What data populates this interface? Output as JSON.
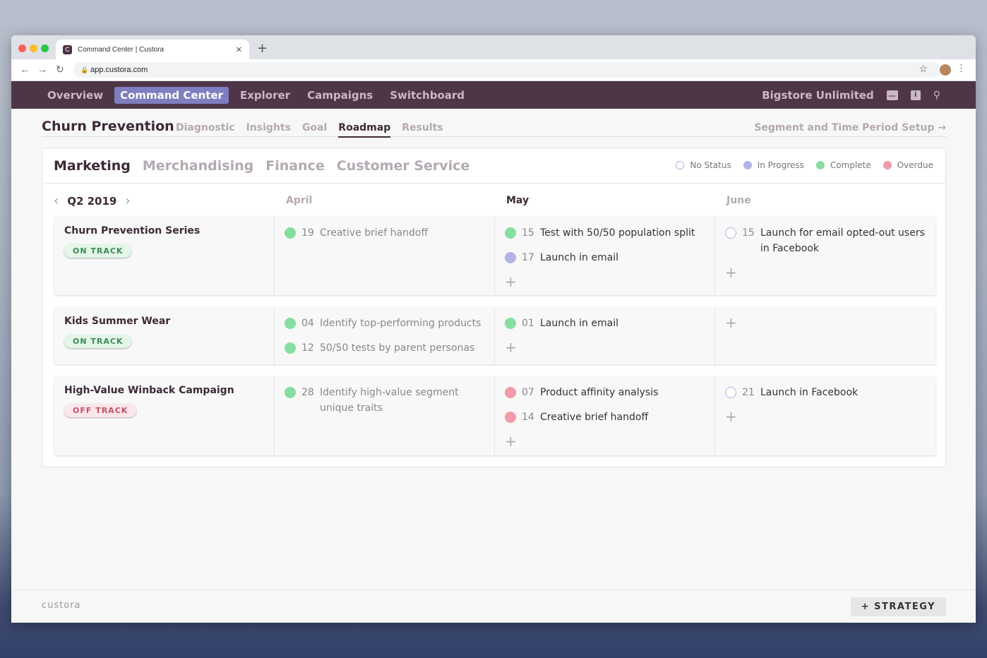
{
  "browser": {
    "tab_title": "Command Center | Custora",
    "url": "app.custora.com"
  },
  "nav": {
    "items": [
      "Overview",
      "Command Center",
      "Explorer",
      "Campaigns",
      "Switchboard"
    ],
    "account": "Bigstore Unlimited"
  },
  "page": {
    "title": "Churn Prevention",
    "tabs": [
      "Diagnostic",
      "Insights",
      "Goal",
      "Roadmap",
      "Results"
    ],
    "setup_link": "Segment and Time Period Setup →"
  },
  "departments": [
    "Marketing",
    "Merchandising",
    "Finance",
    "Customer Service"
  ],
  "legend": [
    {
      "label": "No Status",
      "color": "#ffffff"
    },
    {
      "label": "In Progress",
      "color": "#b3b3e6"
    },
    {
      "label": "Complete",
      "color": "#86dea0"
    },
    {
      "label": "Overdue",
      "color": "#f29aa8"
    }
  ],
  "quarter": "Q2 2019",
  "months": [
    "April",
    "May",
    "June"
  ],
  "strategies": [
    {
      "name": "Churn Prevention Series",
      "status": "ON TRACK",
      "months": [
        [
          {
            "day": "19",
            "text": "Creative brief handoff",
            "state": "complete"
          }
        ],
        [
          {
            "day": "15",
            "text": "Test with 50/50 population split",
            "state": "complete"
          },
          {
            "day": "17",
            "text": "Launch in email",
            "state": "progress"
          }
        ],
        [
          {
            "day": "15",
            "text": "Launch for email opted-out users in Facebook",
            "state": "none"
          }
        ]
      ]
    },
    {
      "name": "Kids Summer Wear",
      "status": "ON TRACK",
      "months": [
        [
          {
            "day": "04",
            "text": "Identify top-performing products",
            "state": "complete"
          },
          {
            "day": "12",
            "text": "50/50 tests by parent personas",
            "state": "complete"
          }
        ],
        [
          {
            "day": "01",
            "text": "Launch in email",
            "state": "complete"
          }
        ],
        []
      ]
    },
    {
      "name": "High-Value Winback Campaign",
      "status": "OFF TRACK",
      "months": [
        [
          {
            "day": "28",
            "text": "Identify high-value segment unique traits",
            "state": "complete"
          }
        ],
        [
          {
            "day": "07",
            "text": "Product affinity analysis",
            "state": "overdue"
          },
          {
            "day": "14",
            "text": "Creative brief handoff",
            "state": "overdue"
          }
        ],
        [
          {
            "day": "21",
            "text": "Launch in Facebook",
            "state": "none"
          }
        ]
      ]
    }
  ],
  "footer": {
    "logo": "custora",
    "button": "STRATEGY"
  }
}
